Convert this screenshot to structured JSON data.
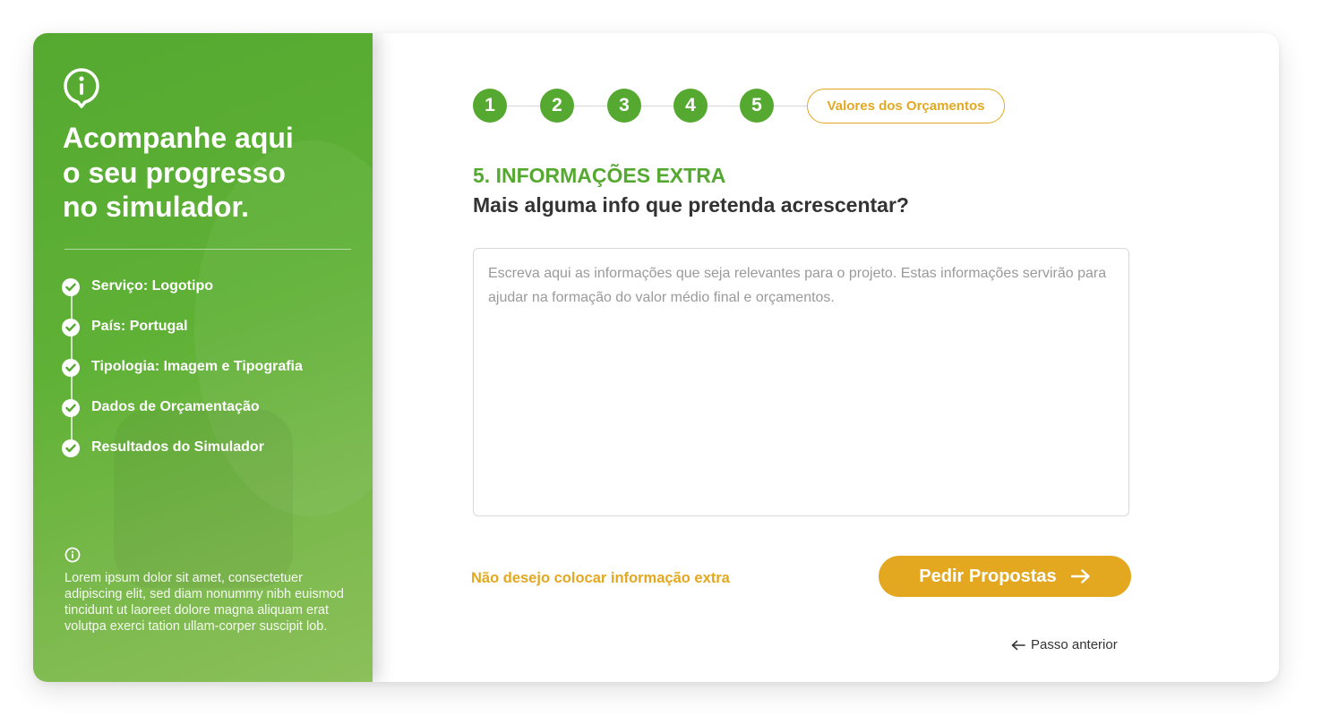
{
  "sidebar": {
    "title": "Acompanhe aqui\no seu progresso\nno simulador.",
    "items": [
      {
        "label": "Serviço: Logotipo"
      },
      {
        "label": "País: Portugal"
      },
      {
        "label": "Tipologia: Imagem e Tipografia"
      },
      {
        "label": "Dados de Orçamentação"
      },
      {
        "label": "Resultados do Simulador"
      }
    ],
    "info_text": "Lorem ipsum dolor sit amet, consectetuer adipiscing elit, sed diam nonummy nibh euismod tincidunt ut laoreet dolore magna aliquam erat volutpa exerci tation ullam-corper suscipit lob."
  },
  "stepper": {
    "steps": [
      "1",
      "2",
      "3",
      "4",
      "5"
    ],
    "final_label": "Valores dos Orçamentos"
  },
  "section": {
    "eyebrow": "5. INFORMAÇÕES EXTRA",
    "title": "Mais alguma info que pretenda acrescentar?"
  },
  "textarea": {
    "value": "",
    "placeholder": "Escreva aqui as informações que seja relevantes para o projeto. Estas informações servirão para ajudar na formação do valor médio final e orçamentos."
  },
  "actions": {
    "skip_label": "Não desejo colocar informação extra",
    "submit_label": "Pedir Propostas",
    "back_label": "Passo anterior"
  },
  "colors": {
    "green": "#55a930",
    "orange": "#e3a820",
    "text": "#333333"
  },
  "icons": [
    "info-icon",
    "check-circle-icon",
    "arrow-right-icon",
    "arrow-left-icon"
  ]
}
